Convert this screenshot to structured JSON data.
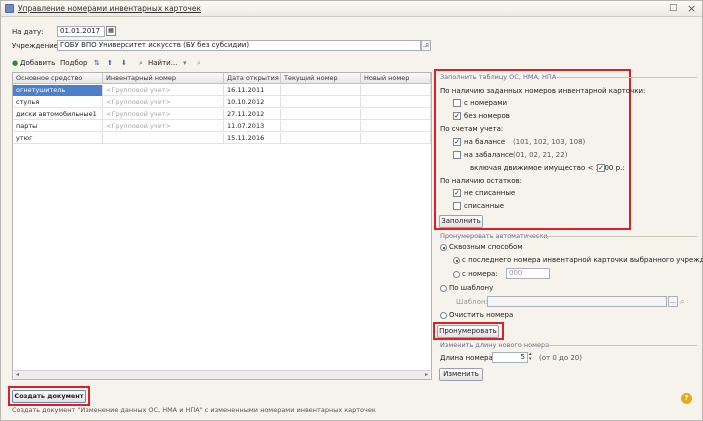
{
  "window": {
    "title": "Управление номерами инвентарных карточек",
    "max_glyph": "□",
    "close_glyph": "×"
  },
  "form": {
    "date_label": "На дату:",
    "date_value": "01.01.2017",
    "org_label": "Учреждение:",
    "org_value": "ГОБУ ВПО Университет искусств (БУ без субсидии)"
  },
  "toolbar": {
    "add": "Добавить",
    "select": "Подбор",
    "find": "Найти..."
  },
  "grid": {
    "columns": [
      "Основное средство",
      "Инвентарный номер",
      "Дата открытия",
      "Текущий номер",
      "Новый номер"
    ],
    "rows": [
      [
        "огнетушитель",
        "<Групповой учет>",
        "16.11.2011",
        "",
        ""
      ],
      [
        "стулья",
        "<Групповой учет>",
        "10.10.2012",
        "",
        ""
      ],
      [
        "диски автомобильные1",
        "<Групповой учет>",
        "27.11.2012",
        "",
        ""
      ],
      [
        "парты",
        "<Групповой учет>",
        "11.07.2013",
        "",
        ""
      ],
      [
        "утюг",
        "",
        "15.11.2016",
        "",
        ""
      ]
    ]
  },
  "fill_group": {
    "title": "Заполнить таблицу ОС, НМА, НПА",
    "by_card_label": "По наличию заданных номеров инвентарной карточки:",
    "with_numbers": "с номерами",
    "with_numbers_checked": false,
    "without_numbers": "без номеров",
    "without_numbers_checked": true,
    "by_accounts_label": "По счетам учета:",
    "on_balance": "на балансе",
    "on_balance_checked": true,
    "on_balance_accounts": "(101, 102, 103, 108)",
    "off_balance": "на забалансе",
    "off_balance_checked": false,
    "off_balance_accounts": "(01, 02, 21, 22)",
    "movable_label": "включая движимое имущество < 3000 р.:",
    "movable_checked": true,
    "by_remains_label": "По наличию остатков:",
    "not_written": "не списанные",
    "not_written_checked": true,
    "written": "списанные",
    "written_checked": false,
    "fill_button": "Заполнить"
  },
  "number_group": {
    "title": "Пронумеровать автоматически",
    "through": "Сквозным способом",
    "from_last": "с последнего номера инвентарной карточки выбранного учреждения",
    "from_number": "с номера:",
    "from_number_value": "000",
    "by_template": "По шаблону",
    "template_label": "Шаблон:",
    "clear": "Очистить номера",
    "number_button": "Пронумеровать"
  },
  "length_group": {
    "title": "Изменить длину нового номера",
    "length_label": "Длина номера:",
    "length_value": "5",
    "length_hint": "(от 0 до 20)",
    "change_button": "Изменить"
  },
  "footer": {
    "create_button": "Создать документ",
    "status": "Создать документ \"Изменение данных ОС, НМА и НПА\" с измененными номерами инвентарных карточек",
    "help": "?"
  }
}
